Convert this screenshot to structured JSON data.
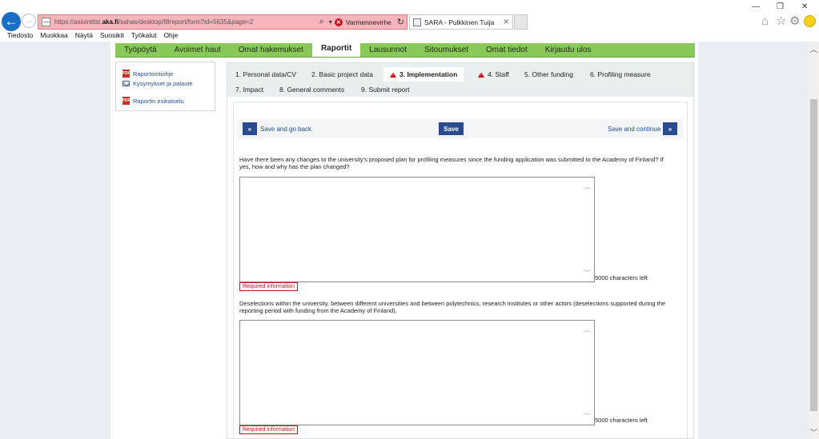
{
  "browser": {
    "back_glyph": "←",
    "forward_glyph": "→",
    "url_prefix": "https://asiointitst.",
    "url_domain": "aka.fi",
    "url_rest": "/sahas/desktop/fillreport/form?id=5635&page=2",
    "cert_error": "Varmennevirhe",
    "search_glyph": "⌕",
    "dropdown_glyph": "▾",
    "refresh_glyph": "↻",
    "cert_error_glyph": "✕",
    "tab_title": "SARA - Pulkkinen Tuija",
    "tab_close_glyph": "✕",
    "window_controls": {
      "minimize": "—",
      "restore": "❐",
      "close": "✕"
    },
    "toolbar_icons": {
      "home": "⌂",
      "favorites": "☆",
      "settings": "⚙"
    }
  },
  "menubar": {
    "items": [
      "Tiedosto",
      "Muokkaa",
      "Näytä",
      "Suosikit",
      "Työkalut",
      "Ohje"
    ]
  },
  "mainnav": {
    "items": [
      "Työpöytä",
      "Avoimet haut",
      "Omat hakemukset",
      "Raportit",
      "Lausunnot",
      "Sitoumukset",
      "Omat tiedot",
      "Kirjaudu ulos"
    ],
    "active": "Raportit"
  },
  "sidebar": {
    "pdf_label": "PDF",
    "links": [
      {
        "label": "Raportointiohje",
        "icon": "pdf-icon"
      },
      {
        "label": "Kysymykset ja palaute",
        "icon": "mail-icon"
      },
      {
        "label": "Raportin esikatselu",
        "icon": "pdf-icon"
      }
    ]
  },
  "report_tabs": {
    "row1": [
      {
        "label": "1. Personal data/CV",
        "warning": false
      },
      {
        "label": "2. Basic project data",
        "warning": false
      },
      {
        "label": "3. Implementation",
        "warning": true,
        "active": true
      },
      {
        "label": "4. Staff",
        "warning": true
      },
      {
        "label": "5. Other funding",
        "warning": false
      },
      {
        "label": "6. Profiling measure",
        "warning": false
      }
    ],
    "row2": [
      {
        "label": "7. Impact"
      },
      {
        "label": "8. General comments"
      },
      {
        "label": "9. Submit report"
      }
    ]
  },
  "actions": {
    "back_glyph": "«",
    "back_label": "Save and go back",
    "save_label": "Save",
    "continue_label": "Save and continue",
    "continue_glyph": "»"
  },
  "scroll": {
    "up_glyph": "︿",
    "down_glyph": "﹀"
  },
  "questions": [
    {
      "text": "Have there been any changes to the university's proposed plan for profiling measures since the funding application was submitted to the Academy of Finland? If yes, how and why has the plan changed?",
      "value": "",
      "chars_left": "5000 characters left",
      "required": "Required information"
    },
    {
      "text": "Deselections within the university, between different universities and between polytechnics, research institutes or other actors (deselections supported during the reporting period with funding from the Academy of Finland).",
      "value": "",
      "chars_left": "5000 characters left",
      "required": "Required information"
    }
  ]
}
